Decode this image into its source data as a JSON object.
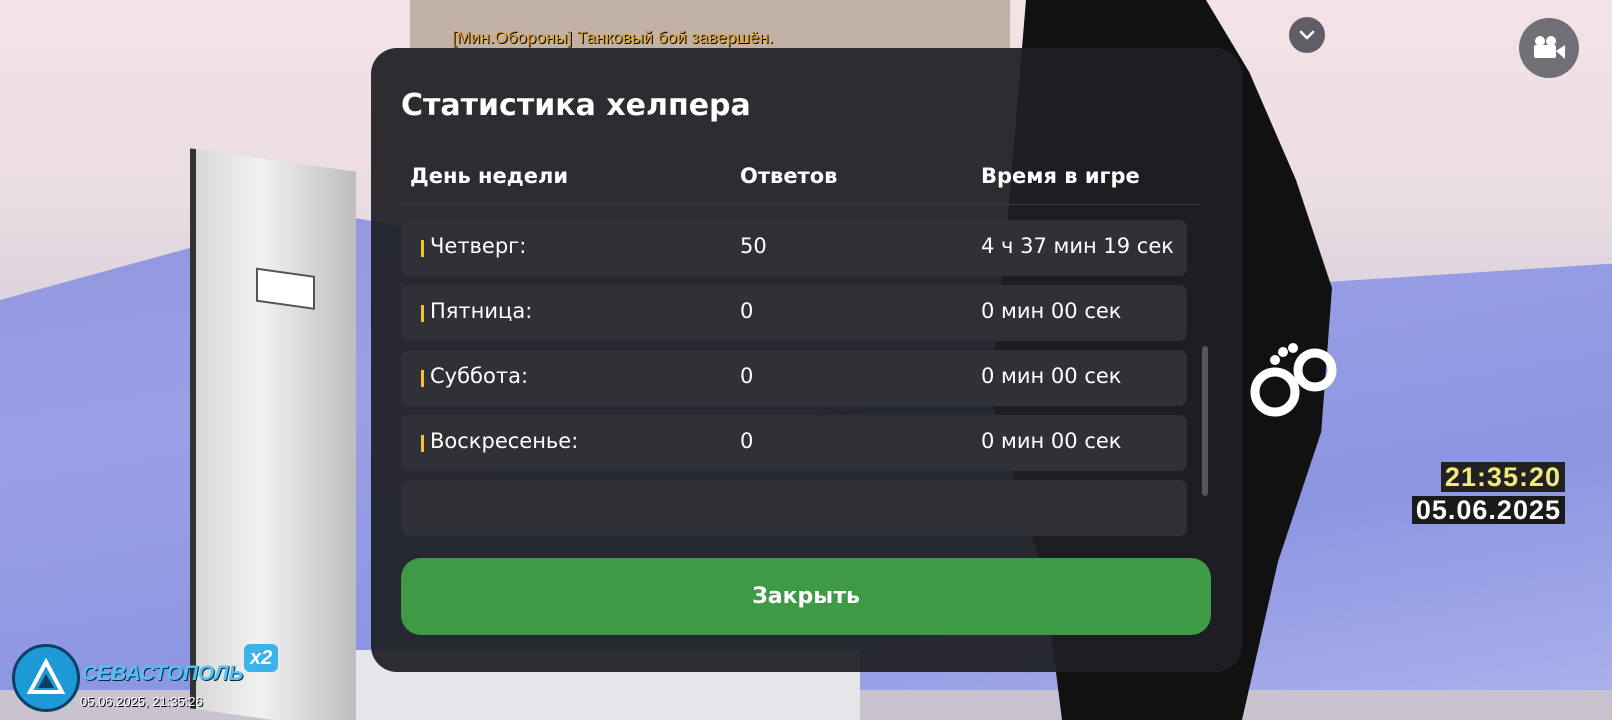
{
  "chat": {
    "lines": [
      "[Мин.Обороны] Танковый бой завершён."
    ]
  },
  "modal": {
    "title": "Статистика хелпера",
    "columns": [
      "День недели",
      "Ответов",
      "Время в игре"
    ],
    "rows": [
      {
        "day": "Четверг:",
        "answers": "50",
        "time": "4 ч 37 мин 19 сек"
      },
      {
        "day": "Пятница:",
        "answers": "0",
        "time": "0 мин 00 сек"
      },
      {
        "day": "Суббота:",
        "answers": "0",
        "time": "0 мин 00 сек"
      },
      {
        "day": "Воскресенье:",
        "answers": "0",
        "time": "0 мин 00 сек"
      }
    ],
    "close_label": "Закрыть",
    "accent_color": "#f2c230",
    "button_color": "#3f9a45"
  },
  "hud": {
    "clock_time": "21:35:20",
    "clock_date": "05.06.2025",
    "chevron_icon": "chevron-down-icon",
    "camera_icon": "video-camera-icon",
    "handcuffs_icon": "handcuffs-icon"
  },
  "server": {
    "name": "СЕВАСТОПОЛЬ",
    "multiplier": "x2",
    "datetime": "05.06.2025, 21:35:26"
  }
}
